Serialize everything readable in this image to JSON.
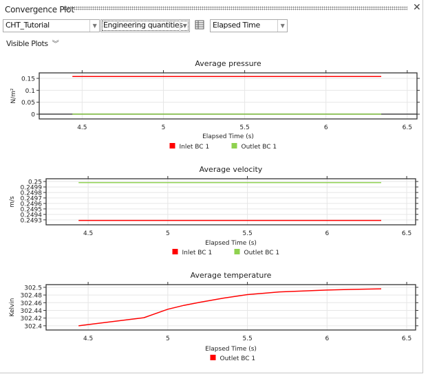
{
  "window": {
    "title": "Convergence Plot",
    "close_icon": "close-icon"
  },
  "toolbar": {
    "simulation": {
      "value": "CHT_Tutorial"
    },
    "quantity_set": {
      "value": "Engineering quantities"
    },
    "table_icon": "table-icon",
    "x_axis": {
      "value": "Elapsed Time"
    }
  },
  "visible_plots": {
    "label": "Visible Plots",
    "icon": "double-chevron-down-icon"
  },
  "chart_data": [
    {
      "type": "line",
      "title": "Average pressure",
      "xlabel": "Elapsed Time (s)",
      "ylabel": "N/m²",
      "xlim": [
        4.236,
        6.56
      ],
      "ylim": [
        -0.02,
        0.173
      ],
      "xticks": [
        4.5,
        5,
        5.5,
        6,
        6.5
      ],
      "xtick_labels": [
        "4.5",
        "5",
        "5.5",
        "6",
        "6.5"
      ],
      "yticks": [
        0,
        0.05,
        0.1,
        0.15
      ],
      "ytick_labels": [
        "0",
        "0.05",
        "0.1",
        "0.15"
      ],
      "grid": true,
      "legend": "bottom",
      "series": [
        {
          "name": "Inlet BC 1",
          "color": "#ff0000",
          "x": [
            4.44,
            6.34
          ],
          "y": [
            0.158,
            0.158
          ]
        },
        {
          "name": "Outlet BC 1",
          "color": "#8fd14f",
          "x": [
            4.44,
            6.34
          ],
          "y": [
            0,
            0
          ]
        }
      ]
    },
    {
      "type": "line",
      "title": "Average velocity",
      "xlabel": "Elapsed Time (s)",
      "ylabel": "m/s",
      "xlim": [
        4.236,
        6.556
      ],
      "ylim": [
        0.24921,
        0.25005
      ],
      "xticks": [
        4.5,
        5,
        5.5,
        6,
        6.5
      ],
      "xtick_labels": [
        "4.5",
        "5",
        "5.5",
        "6",
        "6.5"
      ],
      "yticks": [
        0.2493,
        0.2494,
        0.2495,
        0.2496,
        0.2497,
        0.2498,
        0.2499,
        0.25
      ],
      "ytick_labels": [
        "0.2493",
        "0.2494",
        "0.2495",
        "0.2496",
        "0.2497",
        "0.2498",
        "0.2499",
        "0.25"
      ],
      "grid": true,
      "legend": "bottom",
      "series": [
        {
          "name": "Inlet BC 1",
          "color": "#ff0000",
          "x": [
            4.44,
            6.34
          ],
          "y": [
            0.24929,
            0.24929
          ]
        },
        {
          "name": "Outlet BC 1",
          "color": "#8fd14f",
          "x": [
            4.44,
            6.34
          ],
          "y": [
            0.24998,
            0.24998
          ]
        }
      ]
    },
    {
      "type": "line",
      "title": "Average temperature",
      "xlabel": "Elapsed Time (s)",
      "ylabel": "Kelvin",
      "xlim": [
        4.236,
        6.556
      ],
      "ylim": [
        302.389,
        302.507
      ],
      "xticks": [
        4.5,
        5,
        5.5,
        6,
        6.5
      ],
      "xtick_labels": [
        "4.5",
        "5",
        "5.5",
        "6",
        "6.5"
      ],
      "yticks": [
        302.4,
        302.42,
        302.44,
        302.46,
        302.48,
        302.5
      ],
      "ytick_labels": [
        "302.4",
        "302.42",
        "302.44",
        "302.46",
        "302.48",
        "302.5"
      ],
      "grid": true,
      "legend": "bottom",
      "series": [
        {
          "name": "Outlet BC 1",
          "color": "#ff0000",
          "x": [
            4.44,
            4.85,
            5.0,
            5.1,
            5.2,
            5.35,
            5.5,
            5.7,
            6.0,
            6.2,
            6.34
          ],
          "y": [
            302.4,
            302.421,
            302.443,
            302.453,
            302.461,
            302.472,
            302.481,
            302.488,
            302.493,
            302.495,
            302.496
          ]
        }
      ]
    }
  ]
}
